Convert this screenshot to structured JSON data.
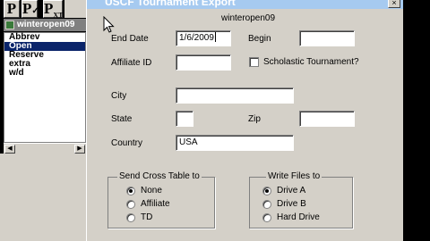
{
  "toolbar": {
    "btn1": "P",
    "btn2": "P",
    "btn2_mark": "✓",
    "btn3": "P",
    "btn3_sub": "XT"
  },
  "left_window": {
    "title": "winteropen09",
    "items": [
      {
        "label": "Abbrev",
        "selected": false
      },
      {
        "label": "Open",
        "selected": true
      },
      {
        "label": "Reserve",
        "selected": false
      },
      {
        "label": "extra",
        "selected": false
      },
      {
        "label": "w/d",
        "selected": false
      }
    ]
  },
  "dialog": {
    "title": "USCF Tournament Export",
    "close_label": "×",
    "tournament_name": "winteropen09",
    "end_date_label": "End Date",
    "end_date_value": "1/6/2009",
    "begin_label": "Begin",
    "begin_value": "",
    "affiliate_id_label": "Affiliate ID",
    "affiliate_id_value": "",
    "scholastic_label": "Scholastic Tournament?",
    "scholastic_checked": false,
    "city_label": "City",
    "city_value": "",
    "state_label": "State",
    "state_value": "",
    "zip_label": "Zip",
    "zip_value": "",
    "country_label": "Country",
    "country_value": "USA",
    "cross_table": {
      "legend": "Send Cross Table to",
      "options": [
        "None",
        "Affiliate",
        "TD"
      ],
      "selected": "None"
    },
    "write_files": {
      "legend": "Write Files to",
      "options": [
        "Drive A",
        "Drive B",
        "Hard Drive"
      ],
      "selected": "Drive A"
    }
  }
}
